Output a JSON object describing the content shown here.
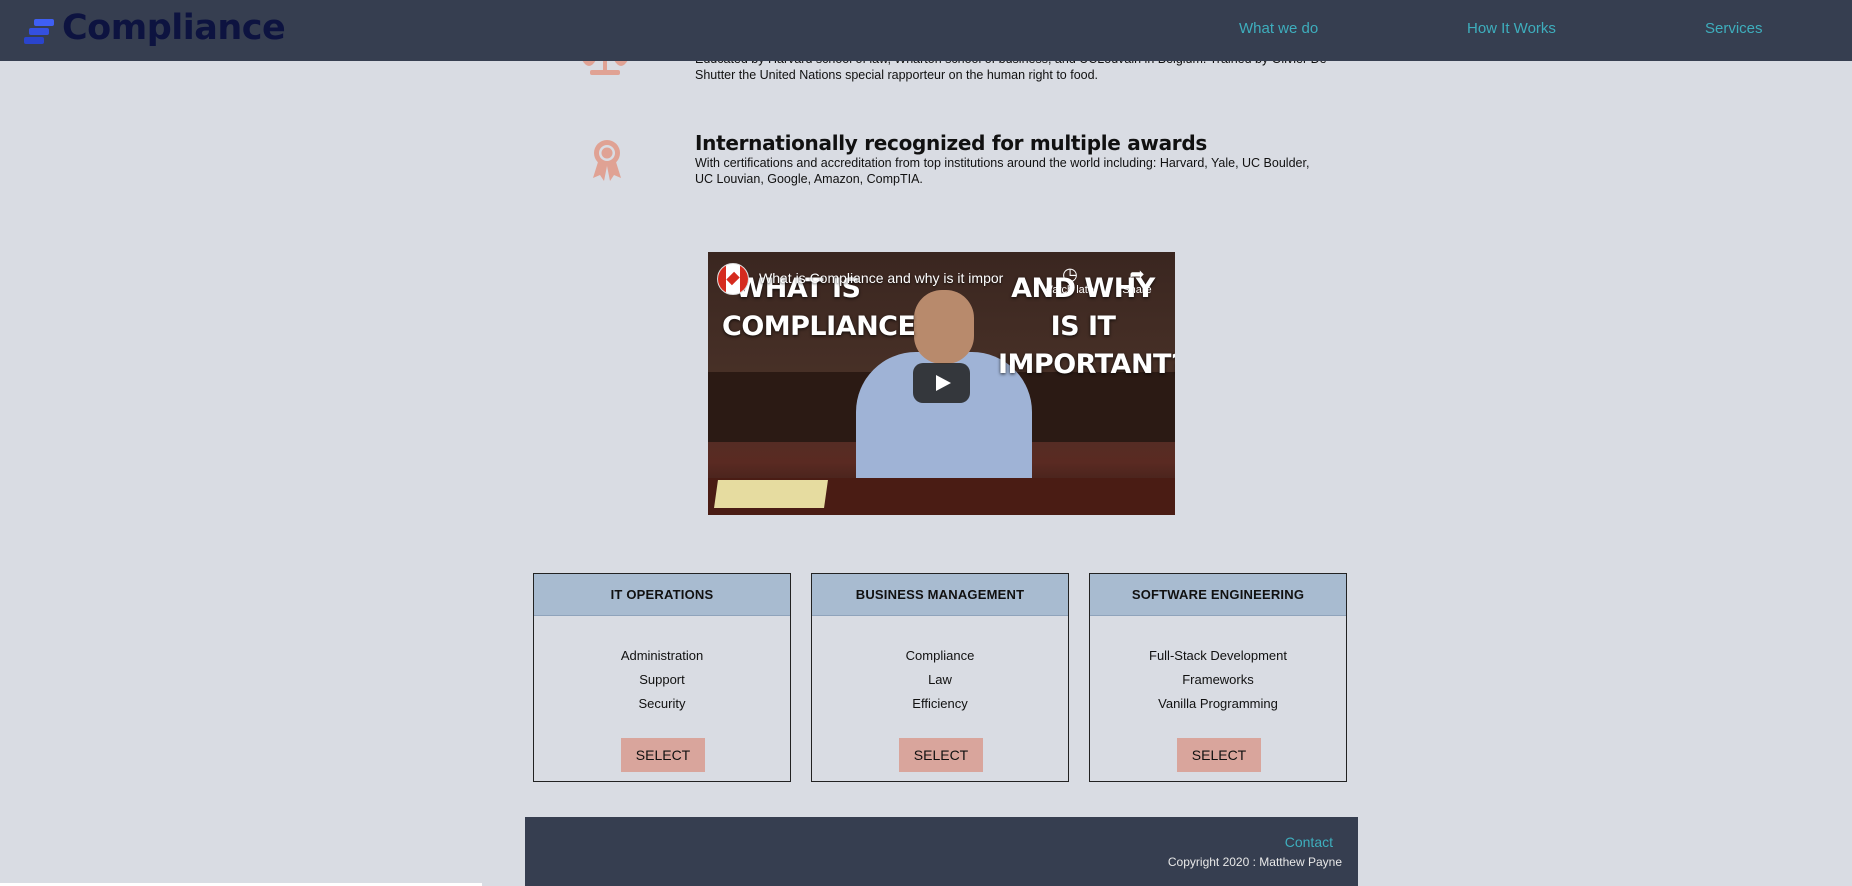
{
  "header": {
    "logo_text": "Compliance",
    "nav": [
      {
        "label": "What we do"
      },
      {
        "label": "How It Works"
      },
      {
        "label": "Services"
      }
    ]
  },
  "features": [
    {
      "icon": "scales-icon",
      "title": "",
      "text_line1": "Educated by Harvard school of law, Wharton school of business, and UCLouvain in Belgium. Trained by Olivier De",
      "text_line2": "Shutter the United Nations special rapporteur on the human right to food."
    },
    {
      "icon": "award-ribbon-icon",
      "title": "Internationally recognized for multiple awards",
      "text_line1": "With certifications and accreditation from top institutions around the world including: Harvard, Yale, UC Boulder,",
      "text_line2": "UC Louvian, Google, Amazon, CompTIA."
    }
  ],
  "video": {
    "title": "What is Compliance and why is it impor",
    "overlay_left": "WHAT IS\nCOMPLIANCE",
    "overlay_left_l1": "WHAT IS",
    "overlay_left_l2": "COMPLIANCE",
    "overlay_right_l1": "AND WHY IS IT",
    "overlay_right_l2": "IMPORTANT?",
    "watch_later_label": "Watch later",
    "share_label": "Share"
  },
  "services": [
    {
      "title": "IT OPERATIONS",
      "items": [
        "Administration",
        "Support",
        "Security"
      ],
      "button": "SELECT"
    },
    {
      "title": "BUSINESS MANAGEMENT",
      "items": [
        "Compliance",
        "Law",
        "Efficiency"
      ],
      "button": "SELECT"
    },
    {
      "title": "SOFTWARE ENGINEERING",
      "items": [
        "Full-Stack Development",
        "Frameworks",
        "Vanilla Programming"
      ],
      "button": "SELECT"
    }
  ],
  "footer": {
    "contact": "Contact",
    "copyright": "Copyright 2020 : Matthew Payne"
  },
  "colors": {
    "header_bg": "#363e50",
    "page_bg": "#d9dce3",
    "link": "#3eaebd",
    "accent_icon": "#e0a294",
    "card_header": "#a8bbd0",
    "select_button": "#d9a59c"
  }
}
